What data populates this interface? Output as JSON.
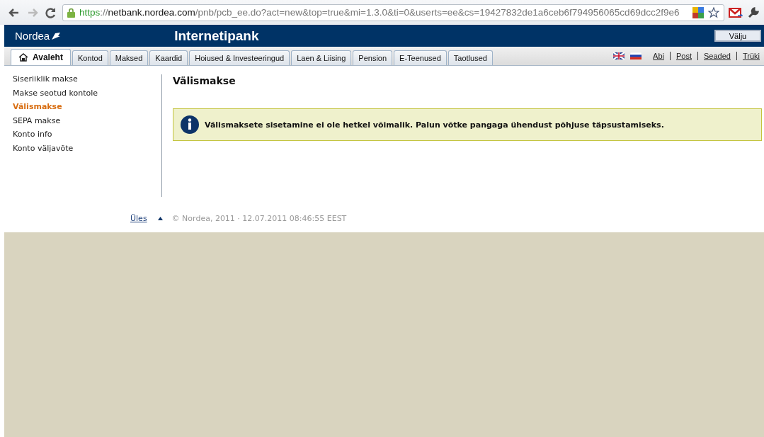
{
  "browser": {
    "url": {
      "scheme": "https",
      "separator": "://",
      "host": "netbank.nordea.com",
      "path": "/pnb/pcb_ee.do?act=new&top=true&mi=1.3.0&ti=0&userts=ee&cs=19427832de1a6ceb6f794956065cd69dcc2f9e6"
    }
  },
  "header": {
    "logo": "Nordea",
    "title": "Internetipank",
    "logout": "Välju"
  },
  "tabs": [
    {
      "label": "Avaleht",
      "selected": true
    },
    {
      "label": "Kontod",
      "selected": false
    },
    {
      "label": "Maksed",
      "selected": false
    },
    {
      "label": "Kaardid",
      "selected": false
    },
    {
      "label": "Hoiused & Investeeringud",
      "selected": false
    },
    {
      "label": "Laen & Liising",
      "selected": false
    },
    {
      "label": "Pension",
      "selected": false
    },
    {
      "label": "E-Teenused",
      "selected": false
    },
    {
      "label": "Taotlused",
      "selected": false
    }
  ],
  "top_links": [
    "Abi",
    "Post",
    "Seaded",
    "Trüki"
  ],
  "sidebar": {
    "items": [
      {
        "label": "Siseriiklik makse",
        "selected": false
      },
      {
        "label": "Makse seotud kontole",
        "selected": false
      },
      {
        "label": "Välismakse",
        "selected": true
      },
      {
        "label": "SEPA makse",
        "selected": false
      },
      {
        "label": "Konto info",
        "selected": false
      },
      {
        "label": "Konto väljavõte",
        "selected": false
      }
    ]
  },
  "content": {
    "heading": "Välismakse",
    "notice": "Välismaksete sisetamine ei ole hetkel võimalik. Palun võtke pangaga ühendust põhjuse täpsustamiseks."
  },
  "footer": {
    "up_link": "Üles",
    "copyright": "© Nordea, 2011 · 12.07.2011 08:46:55 EEST"
  }
}
